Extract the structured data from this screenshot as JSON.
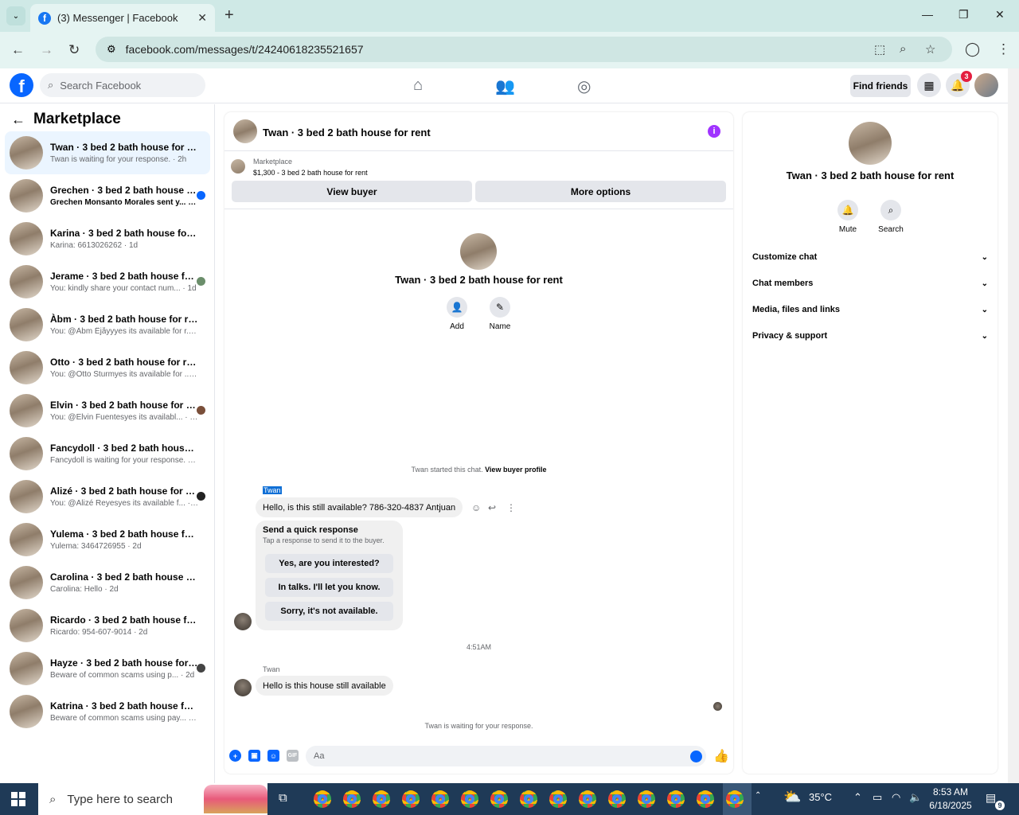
{
  "browser": {
    "tab_title": "(3) Messenger | Facebook",
    "url": "facebook.com/messages/t/24240618235521657"
  },
  "fb_header": {
    "search_placeholder": "Search Facebook",
    "find_friends": "Find friends",
    "notification_count": "3"
  },
  "sidebar": {
    "title": "Marketplace",
    "conversations": [
      {
        "name": "Twan · 3 bed 2 bath house for rent",
        "preview": "Twan is waiting for your response. · 2h",
        "active": true,
        "unread": false
      },
      {
        "name": "Grechen · 3 bed 2 bath house for...",
        "preview": "Grechen Monsanto Morales sent y... · 2h",
        "active": false,
        "unread": true
      },
      {
        "name": "Karina · 3 bed 2 bath house for rent",
        "preview": "Karina: 6613026262 · 1d",
        "active": false,
        "unread": false
      },
      {
        "name": "Jerame · 3 bed 2 bath house for ...",
        "preview": "You: kindly share your contact num... · 1d",
        "active": false,
        "unread": false
      },
      {
        "name": "Àbm · 3 bed 2 bath house for rent",
        "preview": "You: @Àbm Ëjåyyyes its available for r... · 1d",
        "active": false,
        "unread": false
      },
      {
        "name": "Otto · 3 bed 2 bath house for rent",
        "preview": "You: @Otto Sturmyes its available for ... · 1d",
        "active": false,
        "unread": false
      },
      {
        "name": "Elvin · 3 bed 2 bath house for rent",
        "preview": "You: @Elvin Fuentesyes its availabl... · 1d",
        "active": false,
        "unread": false
      },
      {
        "name": "Fancydoll · 3 bed 2 bath house for ...",
        "preview": "Fancydoll is waiting for your response. · 1d",
        "active": false,
        "unread": false
      },
      {
        "name": "Alizé · 3 bed 2 bath house for rent",
        "preview": "You: @Alizé Reyesyes its available f... · 1d",
        "active": false,
        "unread": false
      },
      {
        "name": "Yulema · 3 bed 2 bath house for rent",
        "preview": "Yulema: 3464726955 · 2d",
        "active": false,
        "unread": false
      },
      {
        "name": "Carolina · 3 bed 2 bath house for r...",
        "preview": "Carolina: Hello · 2d",
        "active": false,
        "unread": false
      },
      {
        "name": "Ricardo · 3 bed 2 bath house for re...",
        "preview": "Ricardo: 954-607-9014 · 2d",
        "active": false,
        "unread": false
      },
      {
        "name": "Hayze · 3 bed 2 bath house for r...",
        "preview": "Beware of common scams using p... · 2d",
        "active": false,
        "unread": false
      },
      {
        "name": "Katrina · 3 bed 2 bath house for rent",
        "preview": "Beware of common scams using pay... · 2d",
        "active": false,
        "unread": false
      }
    ]
  },
  "chat": {
    "title": "Twan · 3 bed 2 bath house for rent",
    "marketplace_label": "Marketplace",
    "listing": "$1,300 - 3 bed 2 bath house for rent",
    "view_buyer": "View buyer",
    "more_options": "More options",
    "contact_name": "Twan · 3 bed 2 bath house for rent",
    "add_label": "Add",
    "name_label": "Name",
    "started_text": "Twan started this chat.",
    "view_profile": "View buyer profile",
    "sender": "Twan",
    "message1": "Hello, is this still available? 786-320-4837 Antjuan",
    "quick_title": "Send a quick response",
    "quick_sub": "Tap a response to send it to the buyer.",
    "quick_options": [
      "Yes, are you interested?",
      "In talks. I'll let you know.",
      "Sorry, it's not available."
    ],
    "time": "4:51AM",
    "sender2": "Twan",
    "message2": "Hello is this house still available",
    "waiting": "Twan is waiting for your response.",
    "composer_placeholder": "Aa",
    "gif_label": "GIF"
  },
  "info_panel": {
    "name": "Twan · 3 bed 2 bath house for rent",
    "mute": "Mute",
    "search": "Search",
    "sections": [
      "Customize chat",
      "Chat members",
      "Media, files and links",
      "Privacy & support"
    ]
  },
  "taskbar": {
    "search_placeholder": "Type here to search",
    "temperature": "35°C",
    "time": "8:53 AM",
    "date": "6/18/2025",
    "notification_count": "9"
  },
  "colors": {
    "accent": "#0866ff",
    "info": "#a033ff",
    "active_row": "#ebf5ff",
    "taskbar": "#1f3a57"
  }
}
